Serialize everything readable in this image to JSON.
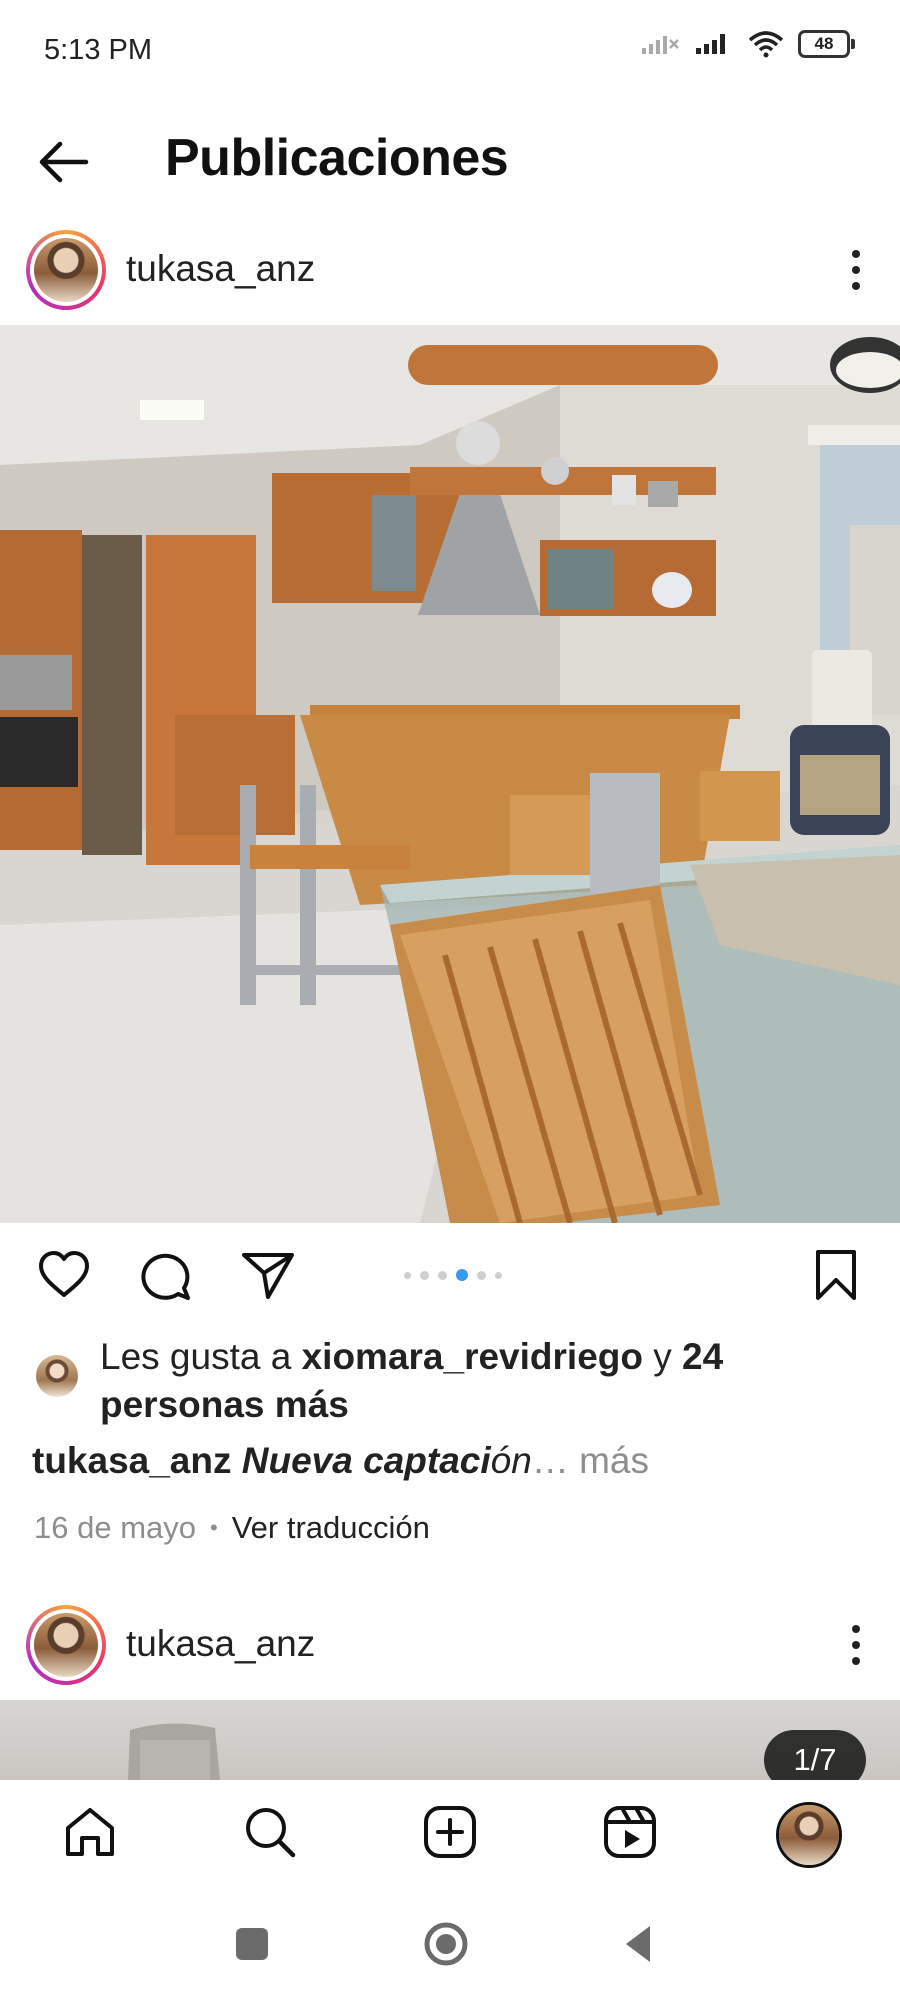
{
  "status_bar": {
    "time": "5:13 PM",
    "battery": "48"
  },
  "header": {
    "title": "Publicaciones"
  },
  "post1": {
    "username": "tukasa_anz",
    "likes_prefix": "Les gusta a ",
    "likes_user": "xiomara_revidriego",
    "likes_mid": " y ",
    "likes_count": "24",
    "likes_suffix": "personas más",
    "caption_user": "tukasa_anz",
    "caption_text": "Nueva captaci",
    "caption_text_end": "ón",
    "caption_more": "… más",
    "date": "16 de mayo",
    "separator": "•",
    "translate": "Ver traducción",
    "carousel": {
      "total_dots": 6,
      "active_index": 3
    }
  },
  "post2": {
    "username": "tukasa_anz",
    "counter": "1/7"
  },
  "colors": {
    "accent": "#3897f0",
    "text": "#222222",
    "muted": "#8e8e8e"
  },
  "icons": {
    "back": "arrow-left-icon",
    "more": "vertical-dots-icon",
    "like": "heart-icon",
    "comment": "comment-icon",
    "share": "paper-plane-icon",
    "save": "bookmark-icon",
    "home": "home-icon",
    "search": "search-icon",
    "create": "plus-square-icon",
    "reels": "reels-icon"
  }
}
